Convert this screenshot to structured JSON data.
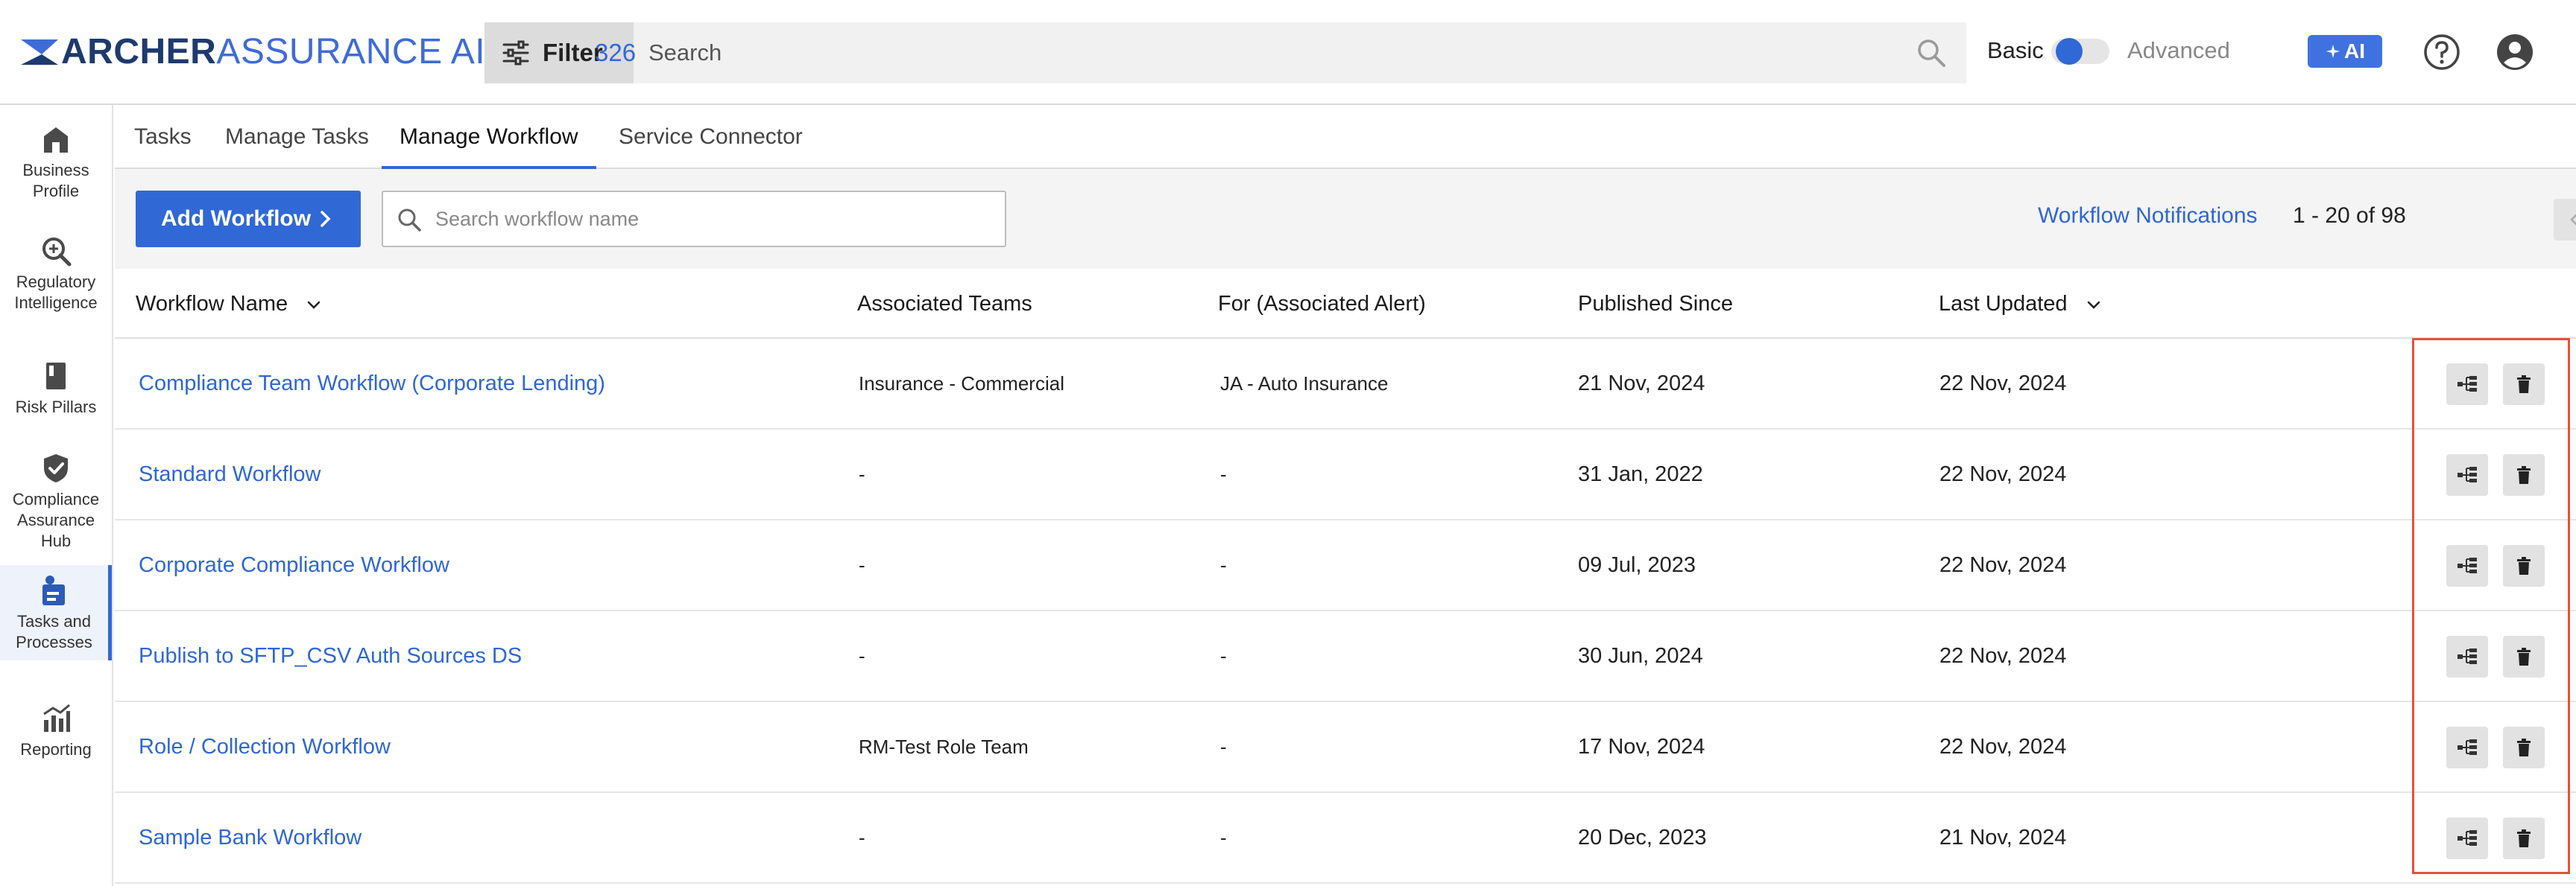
{
  "brand": {
    "part1": "ARCHER",
    "part2": "ASSURANCE AI",
    "icon": "archer-logo-icon"
  },
  "header": {
    "filter_label": "Filter",
    "filter_count": "326",
    "search_placeholder": "Search",
    "mode_basic": "Basic",
    "mode_advanced": "Advanced",
    "mode_selected": "Basic",
    "ai_label": "AI"
  },
  "rail": {
    "items": [
      {
        "label": "Business Profile",
        "icon": "building-icon",
        "active": false
      },
      {
        "label": "Regulatory Intelligence",
        "icon": "magnifier-icon",
        "active": false
      },
      {
        "label": "Risk Pillars",
        "icon": "book-icon",
        "active": false
      },
      {
        "label": "Compliance Assurance Hub",
        "icon": "shield-check-icon",
        "active": false
      },
      {
        "label": "Tasks and Processes",
        "icon": "tasks-icon",
        "active": true
      },
      {
        "label": "Reporting",
        "icon": "chart-icon",
        "active": false
      }
    ]
  },
  "tabs": [
    {
      "label": "Tasks",
      "active": false
    },
    {
      "label": "Manage Tasks",
      "active": false
    },
    {
      "label": "Manage Workflow",
      "active": true
    },
    {
      "label": "Service Connector",
      "active": false
    }
  ],
  "toolbar": {
    "add_label": "Add Workflow",
    "search_placeholder": "Search workflow name",
    "notifications_label": "Workflow Notifications",
    "range": "1 - 20 of 98"
  },
  "table": {
    "columns": [
      "Workflow Name",
      "Associated Teams",
      "For (Associated Alert)",
      "Published Since",
      "Last Updated"
    ],
    "rows": [
      {
        "name": "Compliance Team Workflow (Corporate Lending)",
        "team": "Insurance - Commercial",
        "alert": "JA - Auto Insurance",
        "published": "21 Nov, 2024",
        "updated": "22 Nov, 2024"
      },
      {
        "name": "Standard Workflow",
        "team": "-",
        "alert": "-",
        "published": "31 Jan, 2022",
        "updated": "22 Nov, 2024"
      },
      {
        "name": "Corporate Compliance Workflow",
        "team": "-",
        "alert": "-",
        "published": "09 Jul, 2023",
        "updated": "22 Nov, 2024"
      },
      {
        "name": "Publish to SFTP_CSV Auth Sources DS",
        "team": "-",
        "alert": "-",
        "published": "30 Jun, 2024",
        "updated": "22 Nov, 2024"
      },
      {
        "name": "Role / Collection Workflow",
        "team": "RM-Test Role Team",
        "alert": "-",
        "published": "17 Nov, 2024",
        "updated": "22 Nov, 2024"
      },
      {
        "name": "Sample Bank Workflow",
        "team": "-",
        "alert": "-",
        "published": "20 Dec, 2023",
        "updated": "21 Nov, 2024"
      }
    ]
  },
  "colors": {
    "accent": "#3068d6",
    "link": "#2f66d4",
    "highlight": "#e2523a"
  }
}
